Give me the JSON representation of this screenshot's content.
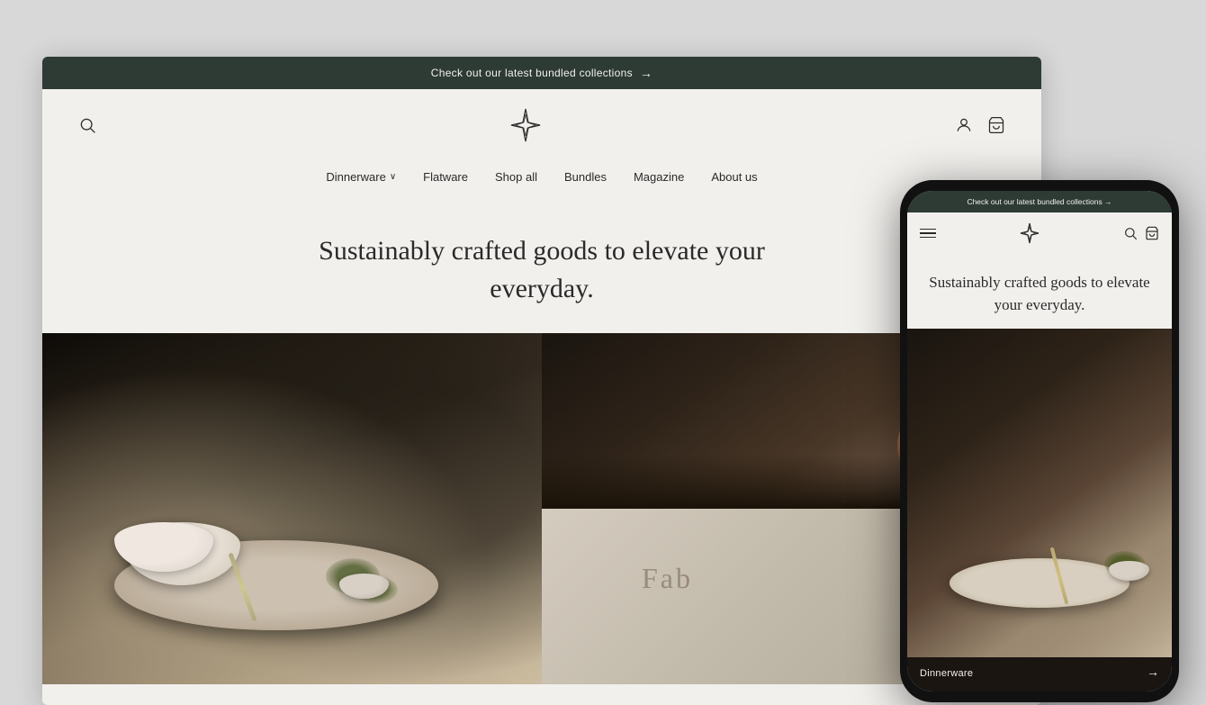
{
  "background_color": "#d8d8d8",
  "announcement": {
    "text": "Check out our latest bundled collections",
    "arrow": "→",
    "bg_color": "#2d3b34"
  },
  "header": {
    "search_label": "search",
    "user_label": "user account",
    "cart_label": "cart"
  },
  "nav": {
    "items": [
      {
        "label": "Dinnerware",
        "has_dropdown": true
      },
      {
        "label": "Flatware",
        "has_dropdown": false
      },
      {
        "label": "Shop all",
        "has_dropdown": false
      },
      {
        "label": "Bundles",
        "has_dropdown": false
      },
      {
        "label": "Magazine",
        "has_dropdown": false
      },
      {
        "label": "About us",
        "has_dropdown": false
      }
    ]
  },
  "hero": {
    "headline": "Sustainably crafted goods to elevate your everyday."
  },
  "phone": {
    "announcement_text": "Check out our latest bundled collections →",
    "headline": "Sustainably crafted goods to elevate your everyday.",
    "bottom_label": "Dinnerware",
    "bottom_arrow": "→"
  }
}
